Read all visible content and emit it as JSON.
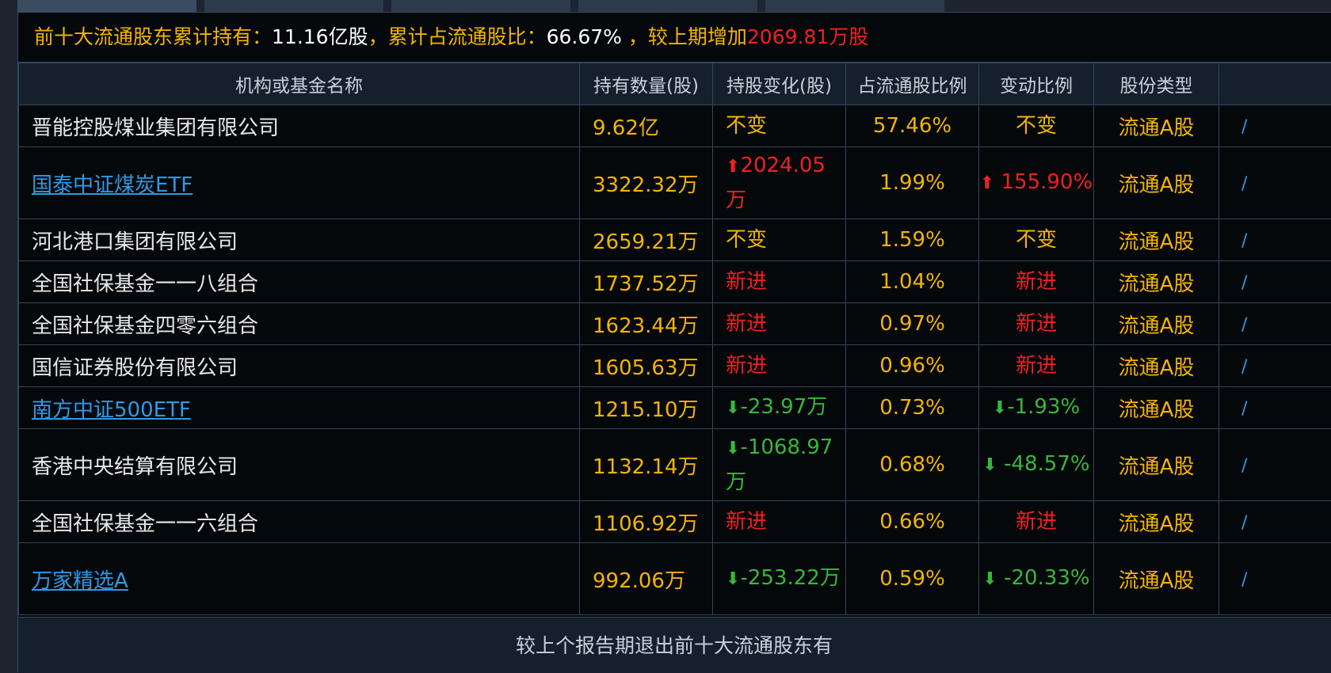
{
  "summary": {
    "prefix": "前十大流通股东累计持有：",
    "holding": "11.16亿股",
    "mid": "，累计占流通股比：",
    "ratio": "66.67%",
    "mid2": " ，较上期增加",
    "increase": "2069.81万股"
  },
  "columns": [
    "机构或基金名称",
    "持有数量(股)",
    "持股变化(股)",
    "占流通股比例",
    "变动比例",
    "股份类型"
  ],
  "rows": [
    {
      "name": "晋能控股煤业集团有限公司",
      "is_link": false,
      "qty": "9.62亿",
      "change": "不变",
      "change_color": "yellow",
      "change_arrow": "",
      "pct": "57.46%",
      "ratio": "不变",
      "ratio_color": "yellow",
      "ratio_arrow": "",
      "type": "流通A股"
    },
    {
      "name": "国泰中证煤炭ETF",
      "is_link": true,
      "qty": "3322.32万",
      "change": "2024.05万",
      "change_color": "red",
      "change_arrow": "up",
      "pct": "1.99%",
      "ratio": " 155.90%",
      "ratio_color": "red",
      "ratio_arrow": "up",
      "type": "流通A股"
    },
    {
      "name": "河北港口集团有限公司",
      "is_link": false,
      "qty": "2659.21万",
      "change": "不变",
      "change_color": "yellow",
      "change_arrow": "",
      "pct": "1.59%",
      "ratio": "不变",
      "ratio_color": "yellow",
      "ratio_arrow": "",
      "type": "流通A股"
    },
    {
      "name": "全国社保基金一一八组合",
      "is_link": false,
      "qty": "1737.52万",
      "change": "新进",
      "change_color": "red",
      "change_arrow": "",
      "pct": "1.04%",
      "ratio": "新进",
      "ratio_color": "red",
      "ratio_arrow": "",
      "type": "流通A股"
    },
    {
      "name": "全国社保基金四零六组合",
      "is_link": false,
      "qty": "1623.44万",
      "change": "新进",
      "change_color": "red",
      "change_arrow": "",
      "pct": "0.97%",
      "ratio": "新进",
      "ratio_color": "red",
      "ratio_arrow": "",
      "type": "流通A股"
    },
    {
      "name": "国信证券股份有限公司",
      "is_link": false,
      "qty": "1605.63万",
      "change": "新进",
      "change_color": "red",
      "change_arrow": "",
      "pct": "0.96%",
      "ratio": "新进",
      "ratio_color": "red",
      "ratio_arrow": "",
      "type": "流通A股"
    },
    {
      "name": "南方中证500ETF",
      "is_link": true,
      "qty": "1215.10万",
      "change": "-23.97万",
      "change_color": "green",
      "change_arrow": "down",
      "pct": "0.73%",
      "ratio": "-1.93%",
      "ratio_color": "green",
      "ratio_arrow": "down",
      "type": "流通A股"
    },
    {
      "name": "香港中央结算有限公司",
      "is_link": false,
      "qty": "1132.14万",
      "change": "-1068.97万",
      "change_color": "green",
      "change_arrow": "down",
      "pct": "0.68%",
      "ratio": " -48.57%",
      "ratio_color": "green",
      "ratio_arrow": "down",
      "type": "流通A股"
    },
    {
      "name": "全国社保基金一一六组合",
      "is_link": false,
      "qty": "1106.92万",
      "change": "新进",
      "change_color": "red",
      "change_arrow": "",
      "pct": "0.66%",
      "ratio": "新进",
      "ratio_color": "red",
      "ratio_arrow": "",
      "type": "流通A股"
    },
    {
      "name": "万家精选A",
      "is_link": true,
      "qty": "992.06万",
      "change": "-253.22万",
      "change_color": "green",
      "change_arrow": "down",
      "pct": "0.59%",
      "ratio": " -20.33%",
      "ratio_color": "green",
      "ratio_arrow": "down",
      "type": "流通A股"
    }
  ],
  "footer": {
    "text": "较上个报告期退出前十大流通股东有"
  },
  "colors": {
    "yellow": "#f4b400",
    "red": "#f02020",
    "green": "#36b83a",
    "link": "#2b9be8",
    "background": "#05080b",
    "grid": "#34465a"
  }
}
